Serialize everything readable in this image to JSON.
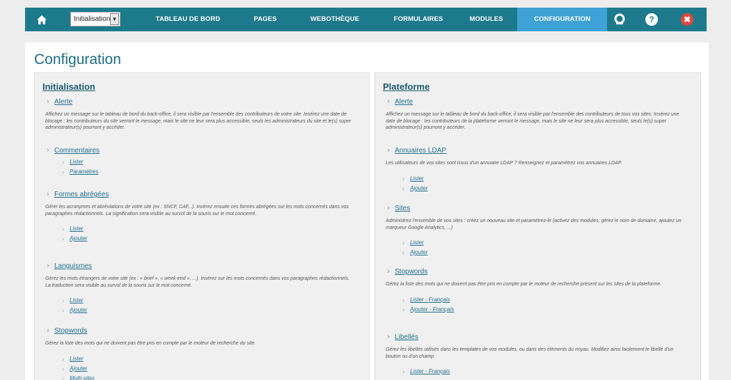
{
  "topbar": {
    "site_select_value": "Initialisation",
    "nav": [
      {
        "label": "TABLEAU DE BORD"
      },
      {
        "label": "PAGES"
      },
      {
        "label": "WEBOTHÈQUE"
      },
      {
        "label": "FORMULAIRES"
      },
      {
        "label": "MODULES"
      },
      {
        "label": "CONFIGURATION",
        "active": true
      }
    ],
    "icons": {
      "home": "home-icon",
      "lifebuoy": "lifebuoy-icon",
      "help": "help-icon",
      "close": "close-icon"
    },
    "help_glyph": "?",
    "close_glyph": "✖"
  },
  "page": {
    "title": "Configuration"
  },
  "left": {
    "title": "Initialisation",
    "sections": [
      {
        "label": "Alerte",
        "desc": "Affichez un message sur le tableau de bord du back-office, il sera visible par l'ensemble des contributeurs de votre site. Insérez une date de blocage : les contributeurs du site verront le message, mais le site ne leur sera plus accessible, seuls les administrateurs du site et le(s) super administrateur(s) pourront y accéder.",
        "links": []
      },
      {
        "label": "Commentaires",
        "desc": "",
        "links": [
          "Lister",
          "Paramètres"
        ]
      },
      {
        "label": "Formes abrégées",
        "desc": "Gérer les acronymes et abréviations de votre site (ex : SNCF, CAF,..). Insérez ensuite ces formes abrégées sur les mots concernés dans vos paragraphes rédactionnels. La signification sera visible au survol de la souris sur le mot concerné.",
        "links": [
          "Lister",
          "Ajouter"
        ]
      },
      {
        "label": "Languismes",
        "desc": "Gérez les mots étrangers de votre site (ex : « brief », « week-end », ...). Insérez sur les mots concernés dans vos paragraphes rédactionnels. La traduction sera visible au survol de la souris sur le mot concerné.",
        "links": [
          "Lister",
          "Ajouter"
        ]
      },
      {
        "label": "Stopwords",
        "desc": "Gérez la liste des mots qui ne doivent pas être pris en compte par le moteur de recherche du site.",
        "links": [
          "Lister",
          "Ajouter",
          "Multi-sites"
        ]
      }
    ]
  },
  "right": {
    "title": "Plateforme",
    "sections": [
      {
        "label": "Alerte",
        "desc": "Affichez un message sur le tableau de bord du back-office, il sera visible par l'ensemble des contributeurs de tous vos sites. Insérez une date de blocage : les contributeurs de la plateforme verront le message, mais le site ne leur sera plus accessible, seuls le(s) super administrateur(s) pourront y accéder.",
        "links": []
      },
      {
        "label": "Annuaires LDAP",
        "desc": "Les utilisateurs de vos sites sont issus d'un annuaire LDAP ? Renseignez et paramétrez vos annuaires LDAP.",
        "links": [
          "Lister",
          "Ajouter"
        ]
      },
      {
        "label": "Sites",
        "desc": "Administrez l'ensemble de vos sites : créez un nouveau site et paramétrez-le (activez des modules, gérez le nom de domaine, ajoutez un marqueur Google Analytics, ...)",
        "links": [
          "Lister",
          "Ajouter"
        ]
      },
      {
        "label": "Stopwords",
        "desc": "Gérez la liste des mots qui ne doivent pas être pris en compte par le moteur de recherche présent sur les sites de la plateforme.",
        "links": [
          "Lister - Français",
          "Ajouter - Français"
        ]
      },
      {
        "label": "Libellés",
        "desc": "Gérez les libellés utilisés dans les templates de vos modules, ou dans des éléments du noyau. Modifiez ainsi facilement le libellé d'un bouton ou d'un champ.",
        "links": [
          "Lister - Français"
        ]
      }
    ]
  }
}
